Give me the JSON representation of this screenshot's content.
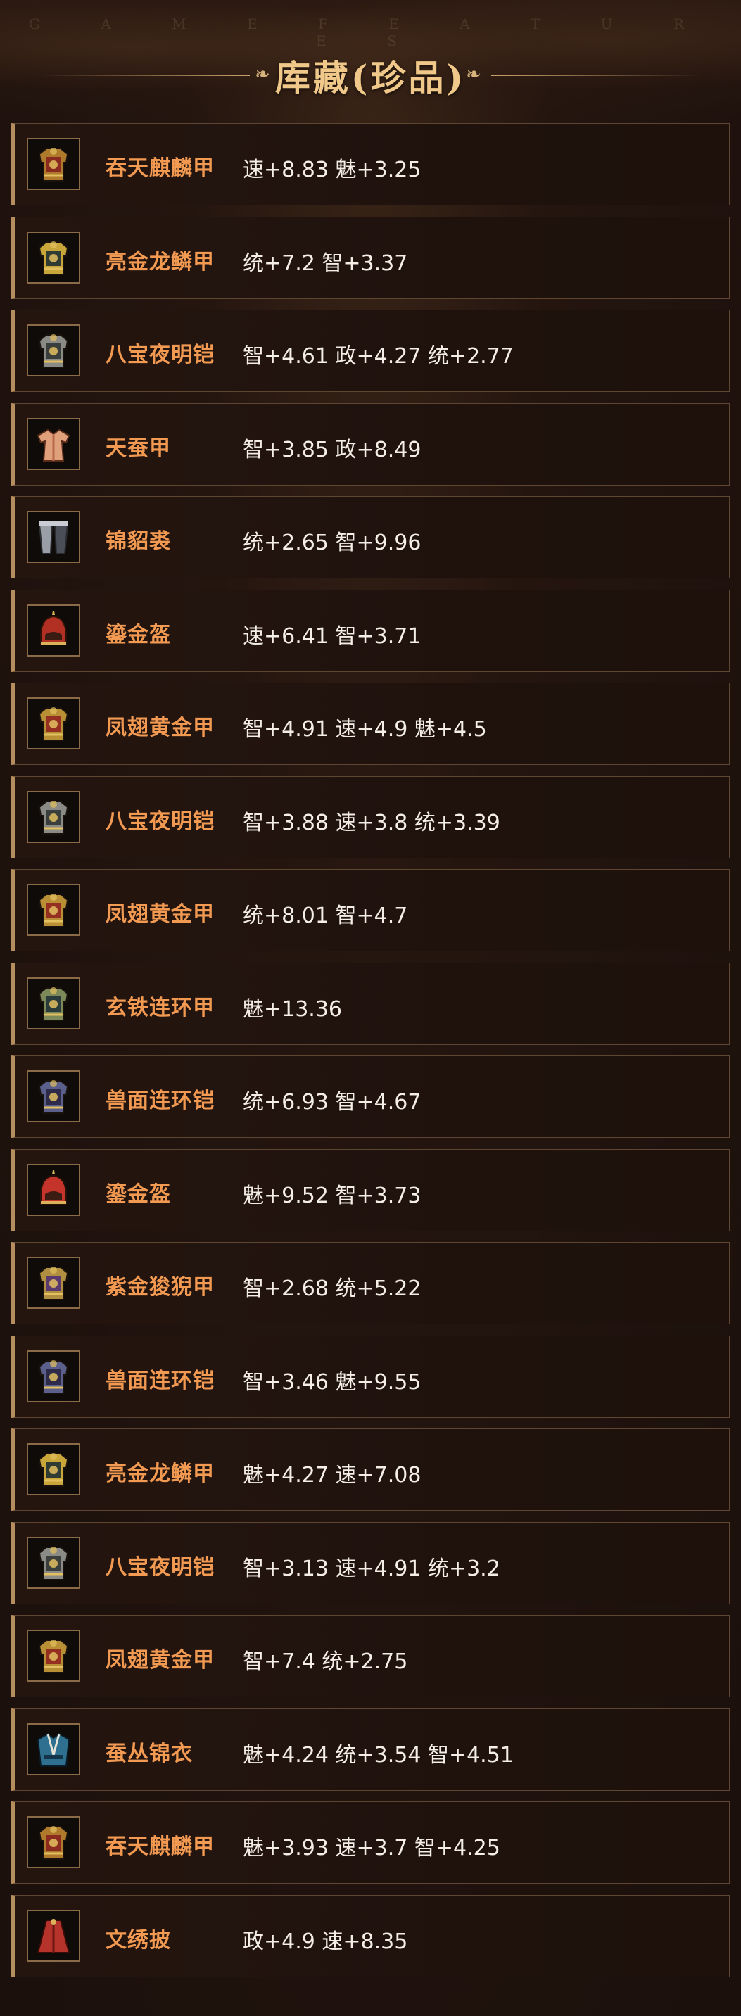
{
  "header": {
    "watermark": "G A M E   F E A T U R E S",
    "title": "库藏(珍品)",
    "ornament": "❧"
  },
  "items": [
    {
      "name": "吞天麒麟甲",
      "stats": "速+8.83 魅+3.25",
      "icon": "gold-red-armor-icon",
      "colors": [
        "#b07a2d",
        "#8b2b1f"
      ]
    },
    {
      "name": "亮金龙鳞甲",
      "stats": "统+7.2 智+3.37",
      "icon": "gold-dragon-armor-icon",
      "colors": [
        "#c8a63a",
        "#2f3b33"
      ]
    },
    {
      "name": "八宝夜明铠",
      "stats": "智+4.61 政+4.27 统+2.77",
      "icon": "silver-armor-icon",
      "colors": [
        "#8a8a86",
        "#3a3e3c"
      ]
    },
    {
      "name": "天蚕甲",
      "stats": "智+3.85 政+8.49",
      "icon": "silk-robe-icon",
      "colors": [
        "#e0a07c",
        "#b86a4a"
      ]
    },
    {
      "name": "锦貂裘",
      "stats": "统+2.65 智+9.96",
      "icon": "fur-coat-icon",
      "colors": [
        "#9a9ea6",
        "#4a4e56"
      ]
    },
    {
      "name": "鎏金盔",
      "stats": "速+6.41 智+3.71",
      "icon": "helmet-icon",
      "colors": [
        "#b22f24",
        "#7a1e15"
      ]
    },
    {
      "name": "凤翅黄金甲",
      "stats": "智+4.91 速+4.9 魅+4.5",
      "icon": "gold-red-armor-icon",
      "colors": [
        "#b88f35",
        "#942f22"
      ]
    },
    {
      "name": "八宝夜明铠",
      "stats": "智+3.88 速+3.8 统+3.39",
      "icon": "silver-armor-icon",
      "colors": [
        "#8a8a86",
        "#3a3e3c"
      ]
    },
    {
      "name": "凤翅黄金甲",
      "stats": "统+8.01 智+4.7",
      "icon": "gold-red-armor-icon",
      "colors": [
        "#b88f35",
        "#942f22"
      ]
    },
    {
      "name": "玄铁连环甲",
      "stats": "魅+13.36",
      "icon": "iron-chain-armor-icon",
      "colors": [
        "#7c8a5a",
        "#2a3b3c"
      ]
    },
    {
      "name": "兽面连环铠",
      "stats": "统+6.93 智+4.67",
      "icon": "beast-armor-icon",
      "colors": [
        "#5a5f8c",
        "#2e2a4a"
      ]
    },
    {
      "name": "鎏金盔",
      "stats": "魅+9.52 智+3.73",
      "icon": "helmet-icon",
      "colors": [
        "#c5342a",
        "#7a1e15"
      ]
    },
    {
      "name": "紫金狻猊甲",
      "stats": "智+2.68 统+5.22",
      "icon": "purple-gold-armor-icon",
      "colors": [
        "#b09040",
        "#5a3a6e"
      ]
    },
    {
      "name": "兽面连环铠",
      "stats": "智+3.46 魅+9.55",
      "icon": "beast-armor-icon",
      "colors": [
        "#5a5f8c",
        "#2e2a4a"
      ]
    },
    {
      "name": "亮金龙鳞甲",
      "stats": "魅+4.27 速+7.08",
      "icon": "gold-dragon-armor-icon",
      "colors": [
        "#c8a63a",
        "#2f3b33"
      ]
    },
    {
      "name": "八宝夜明铠",
      "stats": "智+3.13 速+4.91 统+3.2",
      "icon": "silver-armor-icon",
      "colors": [
        "#8a8a86",
        "#3a3e3c"
      ]
    },
    {
      "name": "凤翅黄金甲",
      "stats": "智+7.4 统+2.75",
      "icon": "gold-red-armor-icon",
      "colors": [
        "#b88f35",
        "#942f22"
      ]
    },
    {
      "name": "蚕丛锦衣",
      "stats": "魅+4.24 统+3.54 智+4.51",
      "icon": "brocade-robe-icon",
      "colors": [
        "#2f6f8f",
        "#14344a"
      ]
    },
    {
      "name": "吞天麒麟甲",
      "stats": "魅+3.93 速+3.7 智+4.25",
      "icon": "gold-red-armor-icon",
      "colors": [
        "#b07a2d",
        "#8b2b1f"
      ]
    },
    {
      "name": "文绣披",
      "stats": "政+4.9 速+8.35",
      "icon": "cape-icon",
      "colors": [
        "#b5332a",
        "#6a1712"
      ]
    }
  ]
}
